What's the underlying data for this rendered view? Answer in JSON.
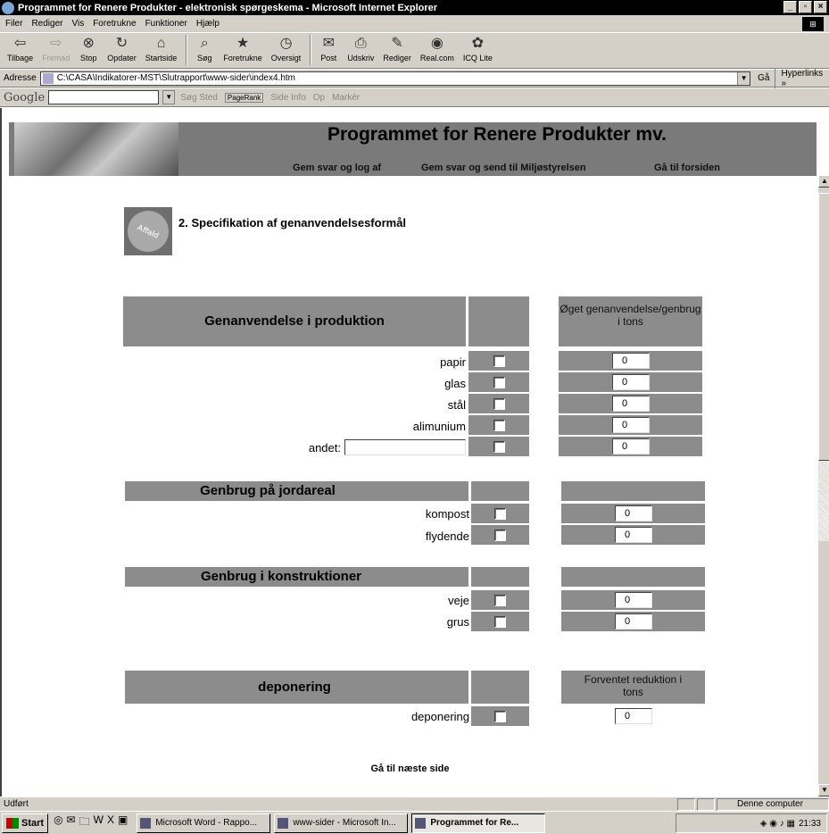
{
  "window": {
    "title": "Programmet for Renere Produkter - elektronisk spørgeskema - Microsoft Internet Explorer"
  },
  "menu": [
    "Filer",
    "Rediger",
    "Vis",
    "Foretrukne",
    "Funktioner",
    "Hjælp"
  ],
  "toolbar": {
    "back": "Tilbage",
    "forward": "Fremad",
    "stop": "Stop",
    "refresh": "Opdater",
    "home": "Startside",
    "search": "Søg",
    "favorites": "Foretrukne",
    "history": "Oversigt",
    "mail": "Post",
    "print": "Udskriv",
    "edit": "Rediger",
    "real": "Real.com",
    "icq": "ICQ Lite"
  },
  "address": {
    "label": "Adresse",
    "value": "C:\\CASA\\Indikatorer-MST\\Slutrapport\\www-sider\\index4.htm",
    "go": "Gå",
    "links": "Hyperlinks »"
  },
  "google": {
    "logo": "Google",
    "search_site": "Søg Sted",
    "pagerank": "PageRank",
    "page_info": "Side Info",
    "up": "Op",
    "highlight": "Markér"
  },
  "page": {
    "banner_title": "Programmet for Renere Produkter mv.",
    "nav": [
      "Gem svar og log af",
      "Gem svar og send til Miljøstyrelsen",
      "Gå til forsiden"
    ],
    "section_icon_text": "Affald",
    "section_title": "2. Specifikation af genanvendelsesformål",
    "sections": [
      {
        "title": "Genanvendelse i produktion",
        "right_header": "Øget genanvendelse/genbrug i tons",
        "rows": [
          {
            "label": "papir",
            "value": "0"
          },
          {
            "label": "glas",
            "value": "0"
          },
          {
            "label": "stål",
            "value": "0"
          },
          {
            "label": "alimunium",
            "value": "0"
          },
          {
            "label": "andet:",
            "value": "0"
          }
        ]
      },
      {
        "title": "Genbrug på jordareal",
        "right_header": "",
        "rows": [
          {
            "label": "kompost",
            "value": "0"
          },
          {
            "label": "flydende",
            "value": "0"
          }
        ]
      },
      {
        "title": "Genbrug i konstruktioner",
        "right_header": "",
        "rows": [
          {
            "label": "veje",
            "value": "0"
          },
          {
            "label": "grus",
            "value": "0"
          }
        ]
      },
      {
        "title": "deponering",
        "right_header": "Forventet reduktion i tons",
        "rows": [
          {
            "label": "deponering",
            "value": "0"
          }
        ]
      }
    ],
    "next_link": "Gå til næste side"
  },
  "status": {
    "text": "Udført",
    "zone": "Denne computer"
  },
  "taskbar": {
    "start": "Start",
    "tasks": [
      "Microsoft Word - Rappo...",
      "www-sider - Microsoft In...",
      "Programmet for Re..."
    ],
    "clock": "21:33"
  }
}
